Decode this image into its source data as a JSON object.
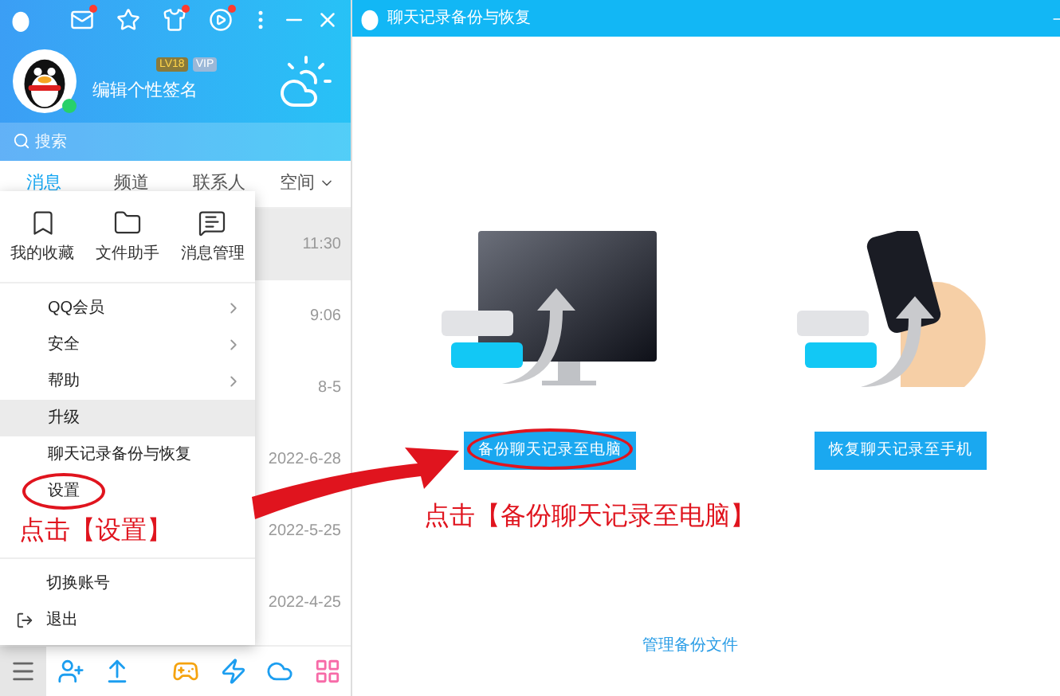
{
  "main_window": {
    "title_bar": {
      "icons": [
        {
          "kind": "mail",
          "dot": true
        },
        {
          "kind": "star",
          "dot": false
        },
        {
          "kind": "shirt",
          "dot": true
        },
        {
          "kind": "play",
          "dot": true
        },
        {
          "kind": "more",
          "dot": false
        },
        {
          "kind": "minimize",
          "dot": false
        },
        {
          "kind": "close",
          "dot": false
        }
      ]
    },
    "profile": {
      "level_badge": "LV18",
      "vip_badge": "VIP",
      "signature": "编辑个性签名",
      "online": true
    },
    "search": {
      "placeholder": "搜索"
    },
    "tabs": [
      {
        "label": "消息",
        "selected": true,
        "dropdown": false
      },
      {
        "label": "频道",
        "selected": false,
        "dropdown": false
      },
      {
        "label": "联系人",
        "selected": false,
        "dropdown": false
      },
      {
        "label": "空间",
        "selected": false,
        "dropdown": true
      }
    ],
    "conversations": [
      {
        "time": "11:30",
        "selected": true
      },
      {
        "time": "9:06",
        "selected": false
      },
      {
        "time": "8-5",
        "selected": false
      },
      {
        "time": "2022-6-28",
        "selected": false
      },
      {
        "time": "2022-5-25",
        "selected": false
      },
      {
        "time": "2022-4-25",
        "selected": false
      }
    ],
    "menu": {
      "shortcuts": [
        {
          "kind": "favorites",
          "label": "我的收藏"
        },
        {
          "kind": "files",
          "label": "文件助手"
        },
        {
          "kind": "messages",
          "label": "消息管理"
        }
      ],
      "items": [
        {
          "label": "QQ会员",
          "kind": "submenu",
          "selected": false,
          "circled": false
        },
        {
          "label": "安全",
          "kind": "submenu",
          "selected": false,
          "circled": false
        },
        {
          "label": "帮助",
          "kind": "submenu",
          "selected": false,
          "circled": false
        },
        {
          "label": "升级",
          "kind": "plain",
          "selected": true,
          "circled": false
        },
        {
          "label": "聊天记录备份与恢复",
          "kind": "plain",
          "selected": false,
          "circled": false
        },
        {
          "label": "设置",
          "kind": "plain",
          "selected": false,
          "circled": true
        }
      ],
      "hint": "点击【设置】",
      "bottom_items": [
        {
          "label": "切换账号",
          "kind": "plain"
        },
        {
          "label": "退出",
          "kind": "exit"
        }
      ]
    },
    "toolbar": [
      {
        "kind": "menu",
        "selected": true
      },
      {
        "kind": "add-contact",
        "selected": false
      },
      {
        "kind": "upload",
        "selected": false
      },
      {
        "kind": "game",
        "selected": false
      },
      {
        "kind": "lightning",
        "selected": false
      },
      {
        "kind": "cloud",
        "selected": false
      },
      {
        "kind": "apps",
        "selected": false
      }
    ]
  },
  "backup_window": {
    "title": "聊天记录备份与恢复",
    "options": [
      {
        "kind": "computer",
        "label": "备份聊天记录至电脑",
        "circled": true
      },
      {
        "kind": "phone",
        "label": "恢复聊天记录至手机",
        "circled": false
      }
    ],
    "hint": "点击【备份聊天记录至电脑】",
    "link": "管理备份文件"
  }
}
